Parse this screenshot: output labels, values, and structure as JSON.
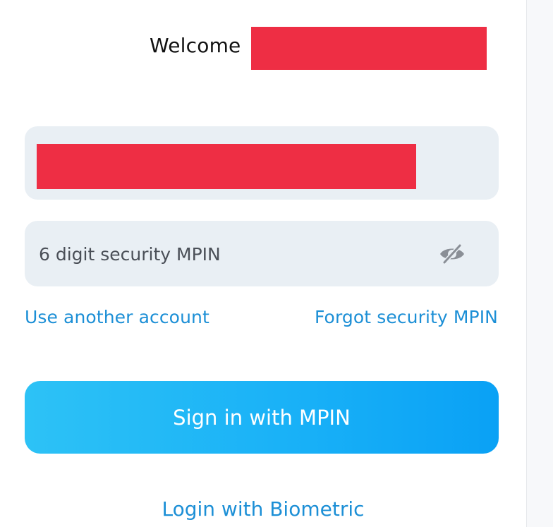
{
  "header": {
    "welcome_label": "Welcome"
  },
  "login_form": {
    "mpin_placeholder": "6 digit security MPIN",
    "visibility_icon": "eye-slash-icon",
    "use_another_account": "Use another account",
    "forgot_mpin": "Forgot security MPIN",
    "sign_in_button": "Sign in with MPIN",
    "biometric_login": "Login with Biometric"
  },
  "colors": {
    "accent": "#1c8fd6",
    "button_gradient_start": "#2dc2f6",
    "button_gradient_end": "#0aa1f5",
    "field_background": "#e9eff4",
    "redaction": "#ee2e44"
  }
}
